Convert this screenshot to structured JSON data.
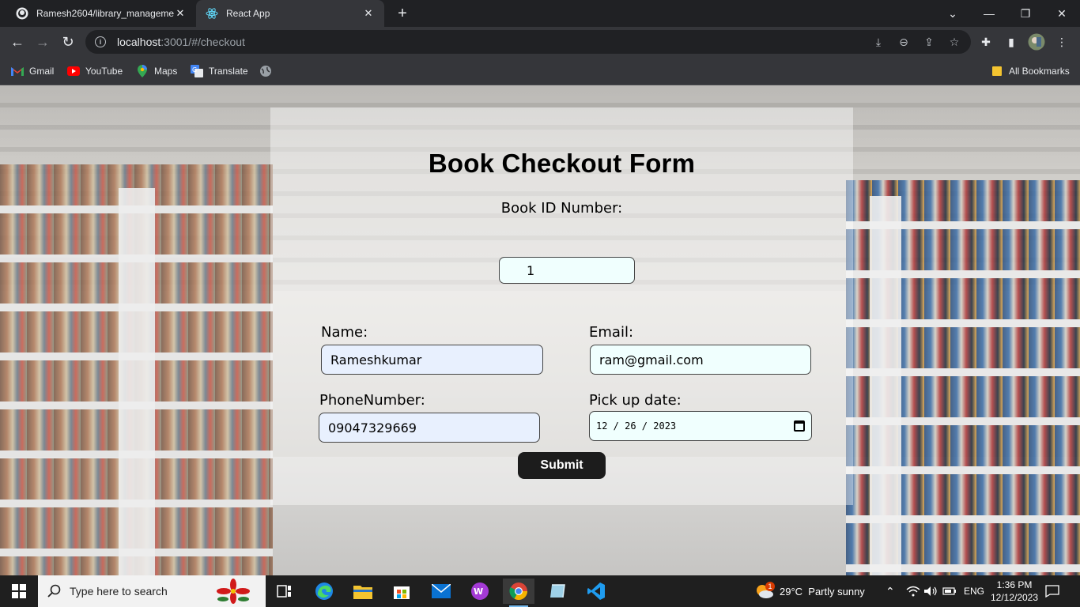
{
  "browser": {
    "tabs": [
      {
        "title": "Ramesh2604/library_manageme",
        "favicon": "github-icon"
      },
      {
        "title": "React App",
        "favicon": "react-icon",
        "active": true
      }
    ],
    "url_host": "localhost",
    "url_rest": ":3001/#/checkout",
    "bookmarks": [
      {
        "label": "Gmail",
        "icon": "gmail-icon"
      },
      {
        "label": "YouTube",
        "icon": "youtube-icon"
      },
      {
        "label": "Maps",
        "icon": "maps-icon"
      },
      {
        "label": "Translate",
        "icon": "translate-icon"
      }
    ],
    "all_bookmarks": "All Bookmarks"
  },
  "form": {
    "title": "Book Checkout Form",
    "book_id_label": "Book ID Number:",
    "book_id_value": "1",
    "name_label": "Name:",
    "name_value": "Rameshkumar",
    "email_label": "Email:",
    "email_value": "ram@gmail.com",
    "phone_label": "PhoneNumber:",
    "phone_value": "09047329669",
    "pickup_label": "Pick up date:",
    "pickup_value": "12 / 26 / 2023",
    "submit_label": "Submit"
  },
  "taskbar": {
    "search_placeholder": "Type here to search",
    "weather": "29°C  Partly sunny",
    "language": "ENG",
    "time": "1:36 PM",
    "date": "12/12/2023",
    "weather_badge": "1"
  }
}
